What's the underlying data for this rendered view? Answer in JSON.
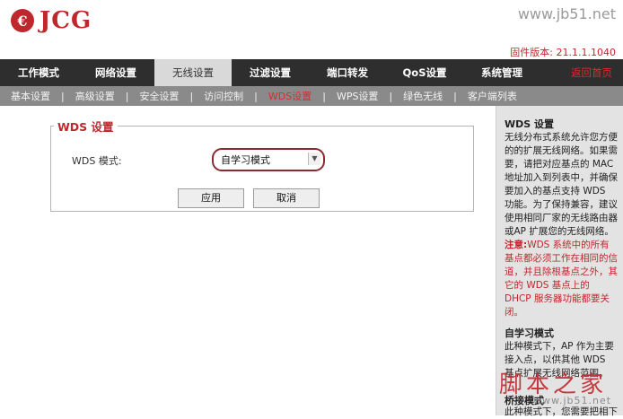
{
  "brand": {
    "logo_mark": "€",
    "logo_text": "JCG",
    "watermark_url": "www.jb51.net"
  },
  "firmware": {
    "label": "固件版本:",
    "value": "21.1.1.1040"
  },
  "main_nav": [
    {
      "label": "工作模式"
    },
    {
      "label": "网络设置"
    },
    {
      "label": "无线设置"
    },
    {
      "label": "过滤设置"
    },
    {
      "label": "端口转发"
    },
    {
      "label": "QoS设置"
    },
    {
      "label": "系统管理"
    }
  ],
  "home_link": "返回首页",
  "sub_nav": [
    {
      "label": "基本设置"
    },
    {
      "label": "高级设置"
    },
    {
      "label": "安全设置"
    },
    {
      "label": "访问控制"
    },
    {
      "label": "WDS设置"
    },
    {
      "label": "WPS设置"
    },
    {
      "label": "绿色无线"
    },
    {
      "label": "客户端列表"
    }
  ],
  "sub_nav_separator": "|",
  "wds": {
    "legend": "WDS 设置",
    "mode_label": "WDS 模式:",
    "mode_value": "自学习模式",
    "apply": "应用",
    "cancel": "取消"
  },
  "sidebar": {
    "title": "WDS 设置",
    "text": "无线分布式系统允许您方便的的扩展无线网络。如果需要，请把对应基点的 MAC 地址加入到列表中，并确保要加入的基点支持 WDS 功能。为了保持兼容，建议使用相同厂家的无线路由器或AP 扩展您的无线网络。",
    "note_label": "注意:",
    "note_text": "WDS 系统中的所有基点都必须工作在相同的信道，并且除根基点之外，其它的 WDS 基点上的 DHCP 服务器功能都要关闭。",
    "section2_title": "自学习模式",
    "section2_text": "此种模式下，AP 作为主要接入点，以供其他 WDS 基点扩展无线网络范围。",
    "section3_title": "桥接模式",
    "section3_text": "此种模式下，您需要把相下"
  },
  "watermark_cn": "脚本之家",
  "watermark_url2": "www.jb51.net"
}
